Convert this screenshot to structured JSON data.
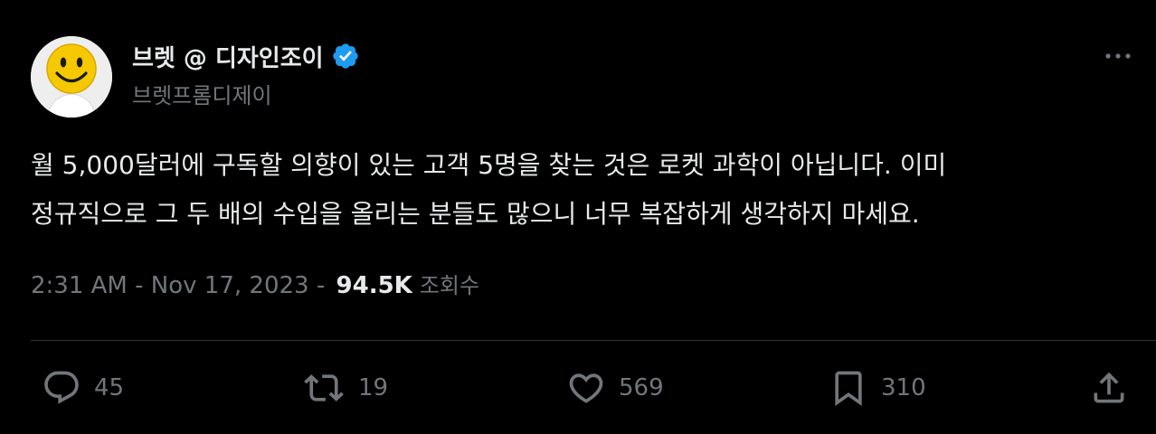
{
  "author": {
    "display_name": "브렛 @ 디자인조이",
    "handle": "브렛프롬디제이",
    "verified": true,
    "avatar_icon": "smiley-face-avatar"
  },
  "tweet": {
    "lines": [
      "월 5,000달러에 구독할 의향이 있는 고객 5명을 찾는 것은 로켓 과학이 아닙니다. 이미",
      "정규직으로 그 두 배의 수입을 올리는 분들도 많으니 너무 복잡하게 생각하지 마세요."
    ]
  },
  "meta": {
    "time": "2:31 AM",
    "separator1": " - ",
    "date": "Nov 17, 2023",
    "separator2": " - ",
    "views_count": "94.5K",
    "views_label": "조회수"
  },
  "actions": {
    "reply": {
      "icon": "reply-icon",
      "count": "45"
    },
    "retweet": {
      "icon": "retweet-icon",
      "count": "19"
    },
    "like": {
      "icon": "heart-icon",
      "count": "569"
    },
    "bookmark": {
      "icon": "bookmark-icon",
      "count": "310"
    },
    "share": {
      "icon": "share-icon"
    }
  },
  "colors": {
    "background": "#000000",
    "text_primary": "#e7e9ea",
    "text_secondary": "#71767b",
    "verified_blue": "#1d9bf0",
    "divider": "#2f3336"
  }
}
